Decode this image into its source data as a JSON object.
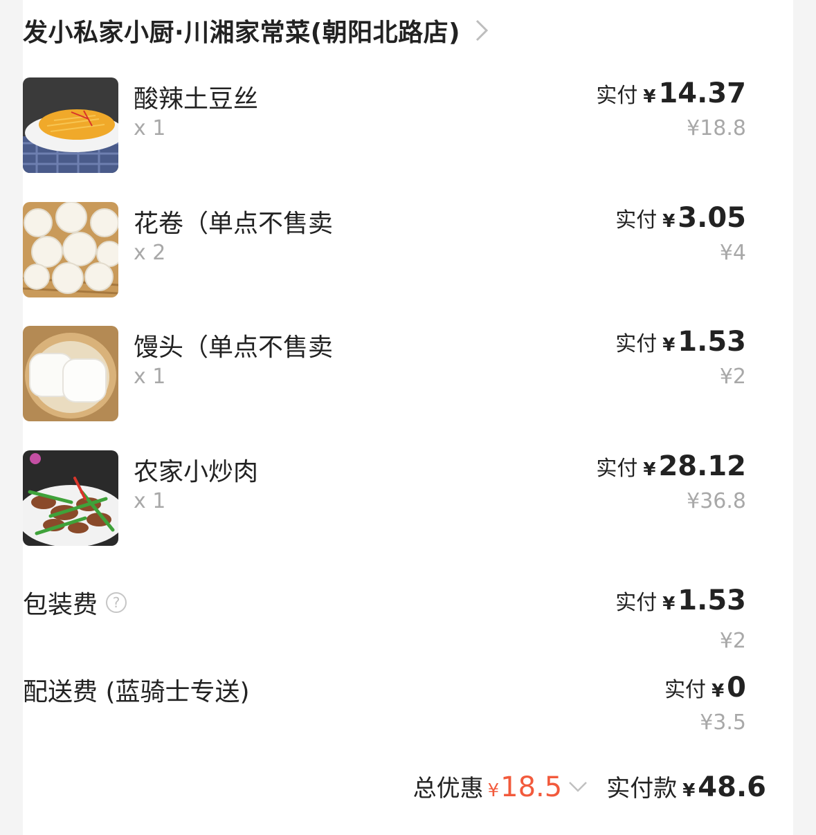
{
  "shop": {
    "name": "发小私家小厨·川湘家常菜(朝阳北路店)"
  },
  "items": [
    {
      "name": "酸辣土豆丝",
      "qty": "x 1",
      "pay_label": "实付",
      "currency": "¥",
      "pay_amount": "14.37",
      "original": "¥18.8",
      "image": "shredded-potato-photo"
    },
    {
      "name": "花卷（单点不售卖",
      "qty": "x 2",
      "pay_label": "实付",
      "currency": "¥",
      "pay_amount": "3.05",
      "original": "¥4",
      "image": "flower-roll-photo"
    },
    {
      "name": "馒头（单点不售卖",
      "qty": "x 1",
      "pay_label": "实付",
      "currency": "¥",
      "pay_amount": "1.53",
      "original": "¥2",
      "image": "steamed-bun-photo"
    },
    {
      "name": "农家小炒肉",
      "qty": "x 1",
      "pay_label": "实付",
      "currency": "¥",
      "pay_amount": "28.12",
      "original": "¥36.8",
      "image": "stir-fried-pork-photo"
    }
  ],
  "packaging": {
    "label": "包装费",
    "pay_label": "实付",
    "currency": "¥",
    "pay_amount": "1.53",
    "original": "¥2",
    "icon": "question-circle-icon"
  },
  "delivery": {
    "label": "配送费 (蓝骑士专送)",
    "pay_label": "实付",
    "currency": "¥",
    "pay_amount": "0",
    "original": "¥3.5"
  },
  "summary": {
    "discount_label": "总优惠",
    "discount_currency": "¥",
    "discount_amount": "18.5",
    "total_label": "实付款",
    "total_currency": "¥",
    "total_amount": "48.6"
  },
  "colors": {
    "accent": "#f25a3c",
    "muted": "#a8a8a8",
    "text": "#222222",
    "background": "#f4f4f4"
  }
}
